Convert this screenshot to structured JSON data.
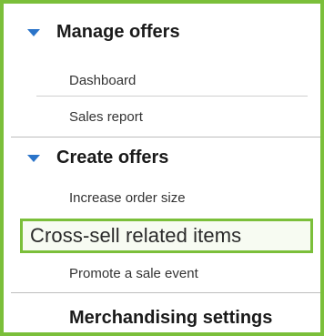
{
  "menu": {
    "manage": {
      "title": "Manage offers",
      "items": [
        "Dashboard",
        "Sales report"
      ]
    },
    "create": {
      "title": "Create offers",
      "items": [
        "Increase order size",
        "Cross-sell related items",
        "Promote a sale event"
      ],
      "selected": "Cross-sell related items"
    },
    "settings": {
      "title": "Merchandising settings"
    }
  },
  "colors": {
    "accent_green": "#7bbf3a",
    "triangle_blue": "#2a74c9"
  },
  "icons": {
    "expand": "triangle-down-icon"
  }
}
